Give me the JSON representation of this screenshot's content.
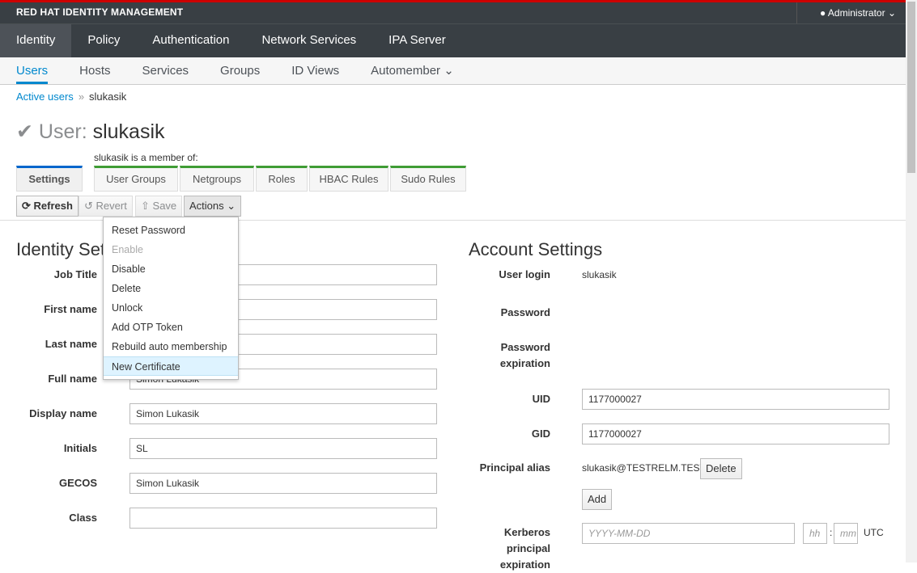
{
  "header": {
    "brand": "RED HAT IDENTITY MANAGEMENT",
    "user": "Administrator"
  },
  "nav": [
    "Identity",
    "Policy",
    "Authentication",
    "Network Services",
    "IPA Server"
  ],
  "subnav": [
    "Users",
    "Hosts",
    "Services",
    "Groups",
    "ID Views",
    "Automember"
  ],
  "breadcrumb": {
    "parent": "Active users",
    "current": "slukasik"
  },
  "title": {
    "prefix": "User:",
    "name": "slukasik"
  },
  "member_of": "slukasik is a member of:",
  "tabs": [
    "Settings",
    "User Groups",
    "Netgroups",
    "Roles",
    "HBAC Rules",
    "Sudo Rules"
  ],
  "toolbar": {
    "refresh": "Refresh",
    "revert": "Revert",
    "save": "Save",
    "actions": "Actions"
  },
  "actions_menu": [
    {
      "label": "Reset Password",
      "enabled": true
    },
    {
      "label": "Enable",
      "enabled": false
    },
    {
      "label": "Disable",
      "enabled": true
    },
    {
      "label": "Delete",
      "enabled": true
    },
    {
      "label": "Unlock",
      "enabled": true
    },
    {
      "label": "Add OTP Token",
      "enabled": true
    },
    {
      "label": "Rebuild auto membership",
      "enabled": true
    },
    {
      "label": "New Certificate",
      "enabled": true,
      "highlighted": true
    }
  ],
  "identity": {
    "heading": "Identity Settings",
    "fields": [
      {
        "label": "Job Title",
        "value": ""
      },
      {
        "label": "First name",
        "value": ""
      },
      {
        "label": "Last name",
        "value": ""
      },
      {
        "label": "Full name",
        "value": "Simon Lukasik"
      },
      {
        "label": "Display name",
        "value": "Simon Lukasik"
      },
      {
        "label": "Initials",
        "value": "SL"
      },
      {
        "label": "GECOS",
        "value": "Simon Lukasik"
      },
      {
        "label": "Class",
        "value": ""
      }
    ]
  },
  "account": {
    "heading": "Account Settings",
    "user_login_label": "User login",
    "user_login": "slukasik",
    "password_label": "Password",
    "password_exp_label": "Password expiration",
    "uid_label": "UID",
    "uid": "1177000027",
    "gid_label": "GID",
    "gid": "1177000027",
    "principal_label": "Principal alias",
    "principal": "slukasik@TESTRELM.TEST",
    "delete": "Delete",
    "add": "Add",
    "kerberos_label": "Kerberos principal expiration",
    "date_ph": "YYYY-MM-DD",
    "hh_ph": "hh",
    "mm_ph": "mm",
    "utc": "UTC"
  },
  "colors": {
    "accent": "#0088ce",
    "nav_bg": "#393f44",
    "brand_red": "#cc0000",
    "tab_green": "#3f9c35"
  }
}
